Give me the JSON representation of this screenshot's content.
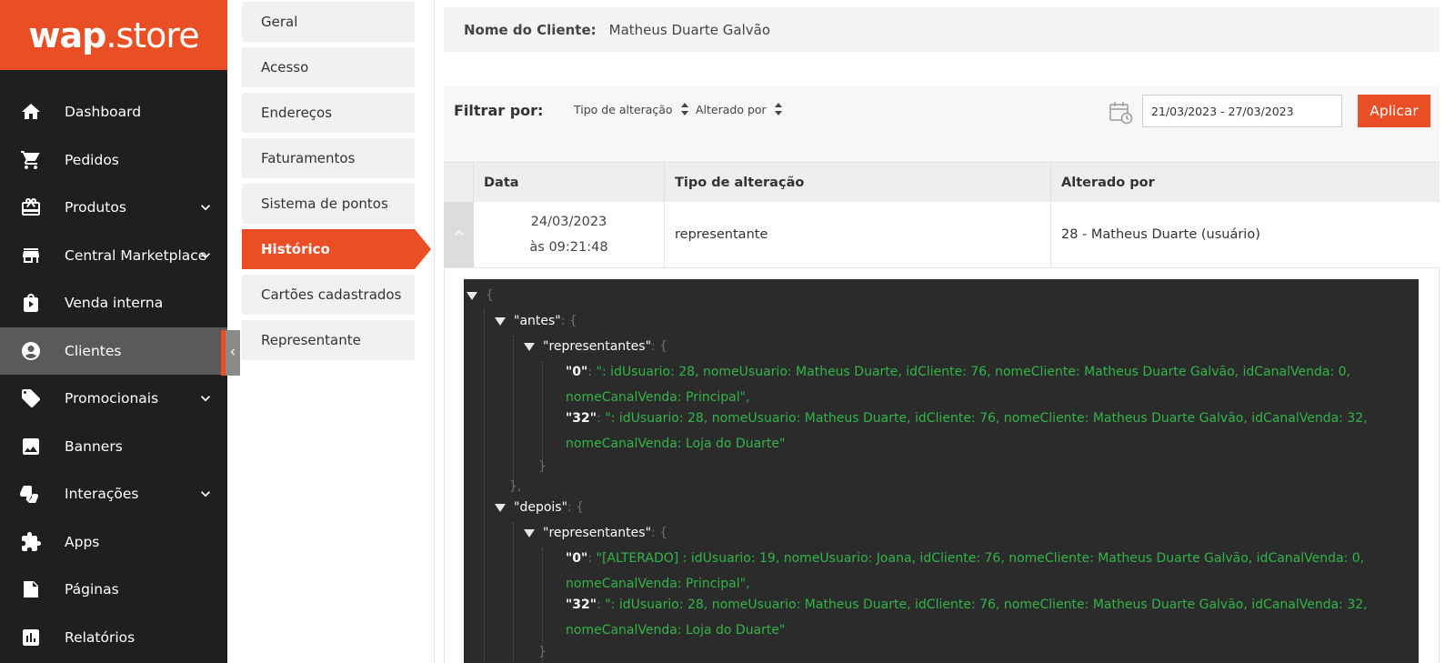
{
  "brand": {
    "bold": "wap",
    "light": ".store",
    "color": "#e94e24"
  },
  "sidebar": {
    "items": [
      {
        "label": "Dashboard",
        "icon": "home-icon",
        "has_submenu": false
      },
      {
        "label": "Pedidos",
        "icon": "cart-icon",
        "has_submenu": false
      },
      {
        "label": "Produtos",
        "icon": "gift-box-icon",
        "has_submenu": true
      },
      {
        "label": "Central Marketplace",
        "icon": "storefront-icon",
        "has_submenu": true
      },
      {
        "label": "Venda interna",
        "icon": "play-bag-icon",
        "has_submenu": false
      },
      {
        "label": "Clientes",
        "icon": "account-circle-icon",
        "has_submenu": false,
        "active": true
      },
      {
        "label": "Promocionais",
        "icon": "tag-icon",
        "has_submenu": true
      },
      {
        "label": "Banners",
        "icon": "image-icon",
        "has_submenu": false
      },
      {
        "label": "Interações",
        "icon": "thumbs-icon",
        "has_submenu": true
      },
      {
        "label": "Apps",
        "icon": "puzzle-icon",
        "has_submenu": false
      },
      {
        "label": "Páginas",
        "icon": "page-icon",
        "has_submenu": false
      },
      {
        "label": "Relatórios",
        "icon": "bar-chart-icon",
        "has_submenu": false
      }
    ]
  },
  "submenu": {
    "items": [
      {
        "label": "Geral"
      },
      {
        "label": "Acesso"
      },
      {
        "label": "Endereços"
      },
      {
        "label": "Faturamentos"
      },
      {
        "label": "Sistema de pontos"
      },
      {
        "label": "Histórico",
        "active": true
      },
      {
        "label": "Cartões cadastrados"
      },
      {
        "label": "Representante"
      }
    ]
  },
  "client": {
    "label": "Nome do Cliente:",
    "name": "Matheus Duarte Galvão"
  },
  "filter": {
    "label": "Filtrar por:",
    "sort_1": "Tipo de alteração",
    "sort_2": "Alterado por",
    "date_range": "21/03/2023 - 27/03/2023",
    "apply_label": "Aplicar"
  },
  "table": {
    "headers": [
      "Data",
      "Tipo de alteração",
      "Alterado por"
    ],
    "rows": [
      {
        "date": "24/03/2023",
        "time": "às 09:21:48",
        "type": "representante",
        "by": "28 - Matheus Duarte (usuário)"
      }
    ]
  },
  "json_viewer": {
    "open_brace": "{",
    "antes_key": "\"antes\"",
    "depois_key": "\"depois\"",
    "representantes_key": "\"representantes\"",
    "colon_brace": ": {",
    "close_brace": "}",
    "close_brace_comma": "},",
    "antes": {
      "k0": "\"0\"",
      "v0_a": "\": idUsuario: 28, nomeUsuario: Matheus Duarte, idCliente: 76, nomeCliente: Matheus Duarte Galvão, idCanalVenda: 0,",
      "v0_b": "nomeCanalVenda: Principal\",",
      "k32": "\"32\"",
      "v32_a": "\": idUsuario: 28, nomeUsuario: Matheus Duarte, idCliente: 76, nomeCliente: Matheus Duarte Galvão, idCanalVenda: 32,",
      "v32_b": "nomeCanalVenda: Loja do Duarte\""
    },
    "depois": {
      "k0": "\"0\"",
      "v0_a": "\"[ALTERADO] : idUsuario: 19, nomeUsuario: Joana, idCliente: 76, nomeCliente: Matheus Duarte Galvão, idCanalVenda: 0,",
      "v0_b": "nomeCanalVenda: Principal\",",
      "k32": "\"32\"",
      "v32_a": "\": idUsuario: 28, nomeUsuario: Matheus Duarte, idCliente: 76, nomeCliente: Matheus Duarte Galvão, idCanalVenda: 32,",
      "v32_b": "nomeCanalVenda: Loja do Duarte\""
    },
    "colors": {
      "background": "#2b2b2b",
      "string": "#32b548",
      "key": "#ffffff",
      "punctuation": "#6e6e6e"
    }
  }
}
